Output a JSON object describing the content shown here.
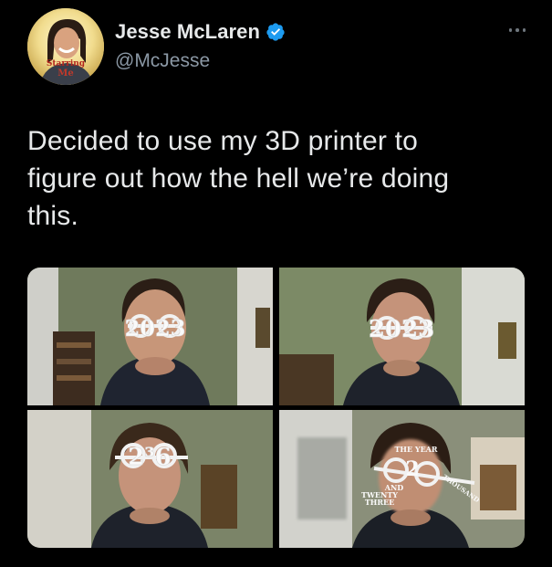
{
  "tweet": {
    "author": {
      "display_name": "Jesse McLaren",
      "handle": "@McJesse",
      "verified": true,
      "avatar_caption_line1": "Starring",
      "avatar_caption_line2": "Me"
    },
    "text": "Decided to use my 3D printer to\nfigure out how the hell we’re doing\nthis.",
    "media": [
      {
        "glasses_text": "2023"
      },
      {
        "glasses_text": "2023"
      },
      {
        "glasses_text": "2³·6"
      },
      {
        "glasses_text": "THE YEAR 2 THOUSAND AND TWENTY THREE"
      }
    ]
  },
  "icons": {
    "verified": "verified-badge-icon",
    "more": "more-options-icon"
  },
  "colors": {
    "background": "#000000",
    "text_primary": "#e7e9ea",
    "text_secondary": "#8b98a5",
    "verified": "#1d9bf0"
  }
}
